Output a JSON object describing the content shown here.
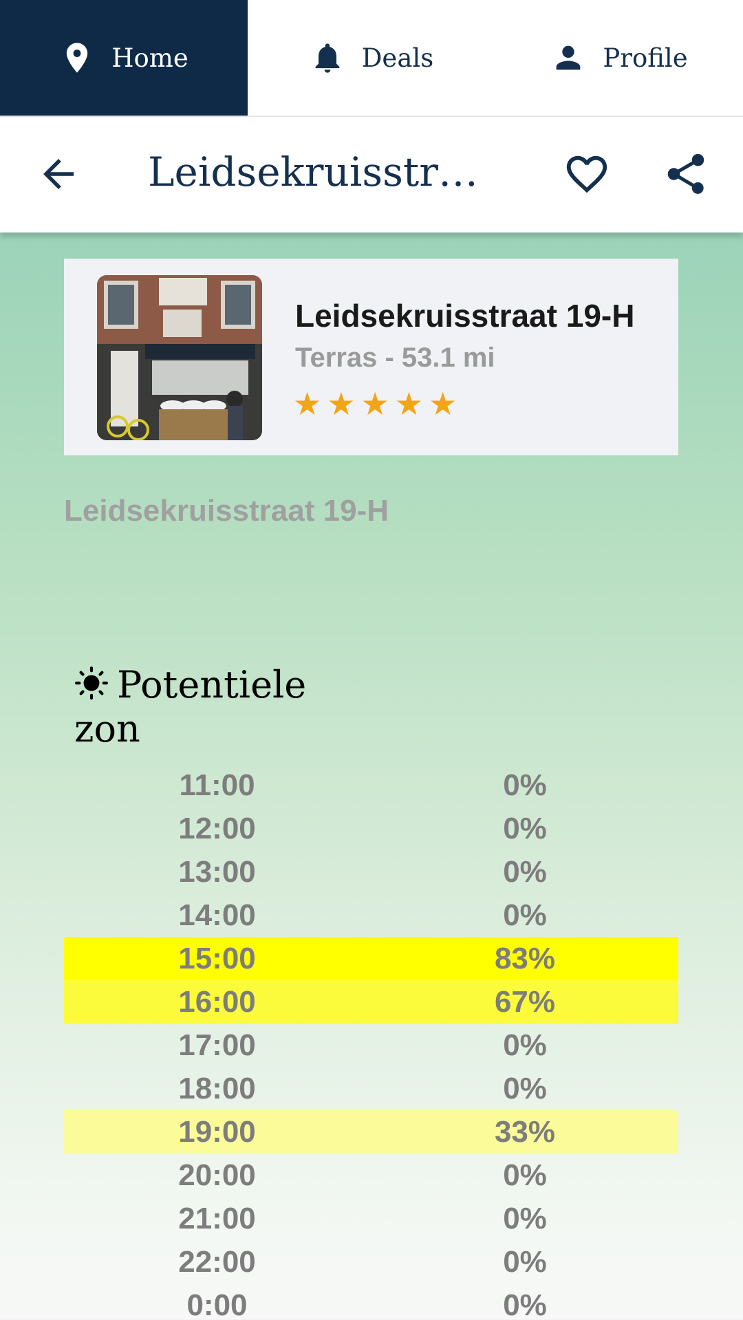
{
  "nav": {
    "tabs": [
      {
        "label": "Home",
        "icon": "location-pin-icon",
        "active": true
      },
      {
        "label": "Deals",
        "icon": "bell-icon",
        "active": false
      },
      {
        "label": "Profile",
        "icon": "person-icon",
        "active": false
      }
    ]
  },
  "header": {
    "title": "Leidsekruisstraat 19-H"
  },
  "card": {
    "name": "Leidsekruisstraat 19-H",
    "subtitle": "Terras - 53.1 mi",
    "rating": 5,
    "stars": [
      "★",
      "★",
      "★",
      "★",
      "★"
    ]
  },
  "address": "Leidsekruisstraat 19-H",
  "sun": {
    "title": "Potentiele zon",
    "rows": [
      {
        "time": "11:00",
        "percent": "0%"
      },
      {
        "time": "12:00",
        "percent": "0%"
      },
      {
        "time": "13:00",
        "percent": "0%"
      },
      {
        "time": "14:00",
        "percent": "0%"
      },
      {
        "time": "15:00",
        "percent": "83%"
      },
      {
        "time": "16:00",
        "percent": "67%"
      },
      {
        "time": "17:00",
        "percent": "0%"
      },
      {
        "time": "18:00",
        "percent": "0%"
      },
      {
        "time": "19:00",
        "percent": "33%"
      },
      {
        "time": "20:00",
        "percent": "0%"
      },
      {
        "time": "21:00",
        "percent": "0%"
      },
      {
        "time": "22:00",
        "percent": "0%"
      },
      {
        "time": "0:00",
        "percent": "0%"
      }
    ]
  },
  "colors": {
    "nav_active": "#0f2a47",
    "primary_text": "#15304f",
    "star": "#f2a516",
    "highlight_strong": "#ffff00",
    "highlight_mid": "#fbfb3c",
    "highlight_light": "#fbfb9a"
  }
}
